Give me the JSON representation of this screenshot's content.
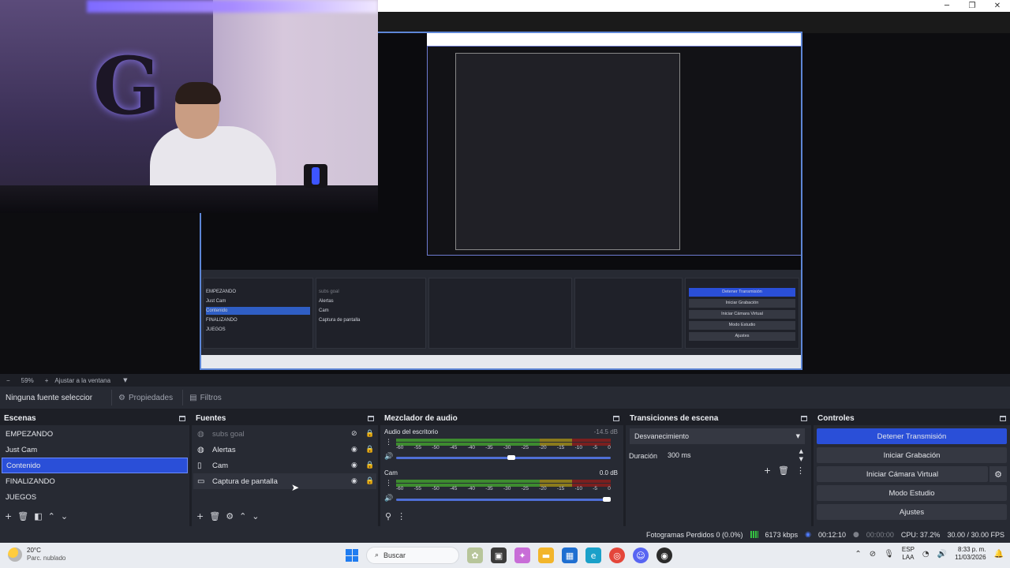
{
  "window": {
    "minimize": "─",
    "restore": "❐",
    "close": "✕"
  },
  "zoom": {
    "minus": "−",
    "level": "59%",
    "plus": "+",
    "fit_label": "Ajustar a la ventana",
    "caret": "▼"
  },
  "source_bar": {
    "no_selection": "Ninguna fuente seleccionada",
    "properties": "Propiedades",
    "filters": "Filtros"
  },
  "scenes": {
    "title": "Escenas",
    "items": [
      {
        "label": "EMPEZANDO",
        "selected": false
      },
      {
        "label": "Just Cam",
        "selected": false
      },
      {
        "label": "Contenido",
        "selected": true
      },
      {
        "label": "FINALIZANDO",
        "selected": false
      },
      {
        "label": "JUEGOS",
        "selected": false
      }
    ]
  },
  "sources": {
    "title": "Fuentes",
    "items": [
      {
        "label": "subs goal",
        "icon": "globe-icon",
        "visible": false
      },
      {
        "label": "Alertas",
        "icon": "globe-icon",
        "visible": true
      },
      {
        "label": "Cam",
        "icon": "file-icon",
        "visible": true
      },
      {
        "label": "Captura de pantalla",
        "icon": "monitor-icon",
        "visible": true
      }
    ]
  },
  "mixer": {
    "title": "Mezclador de audio",
    "channels": [
      {
        "name": "Audio del escritorio",
        "db": "-14.5 dB",
        "db_color": "#8a8d96",
        "volume": 0.54
      },
      {
        "name": "Cam",
        "db": "0.0 dB",
        "db_color": "#e4e6eb",
        "volume": 1.0
      }
    ],
    "ticks": [
      "-60",
      "-55",
      "-50",
      "-45",
      "-40",
      "-35",
      "-30",
      "-25",
      "-20",
      "-15",
      "-10",
      "-5",
      "0"
    ]
  },
  "transitions": {
    "title": "Transiciones de escena",
    "selected": "Desvanecimiento",
    "duration_label": "Duración",
    "duration_value": "300 ms"
  },
  "controls": {
    "title": "Controles",
    "stop_stream": "Detener Transmisión",
    "start_recording": "Iniciar Grabación",
    "start_virtual_cam": "Iniciar Cámara Virtual",
    "studio_mode": "Modo Estudio",
    "settings": "Ajustes"
  },
  "status": {
    "dropped_frames": "Fotogramas Perdidos 0 (0.0%)",
    "bitrate": "6173 kbps",
    "stream_time": "00:12:10",
    "record_time": "00:00:00",
    "cpu": "CPU: 37.2%",
    "fps": "30.00 / 30.00 FPS"
  },
  "taskbar": {
    "temperature": "20°C",
    "weather": "Parc. nublado",
    "search_placeholder": "Buscar",
    "lang_top": "ESP",
    "lang_bottom": "LAA",
    "time": "8:33 p. m.",
    "date": "11/03/2026"
  },
  "colors": {
    "accent": "#2a4fd8",
    "panel": "#272a33",
    "background": "#1d1f26"
  }
}
